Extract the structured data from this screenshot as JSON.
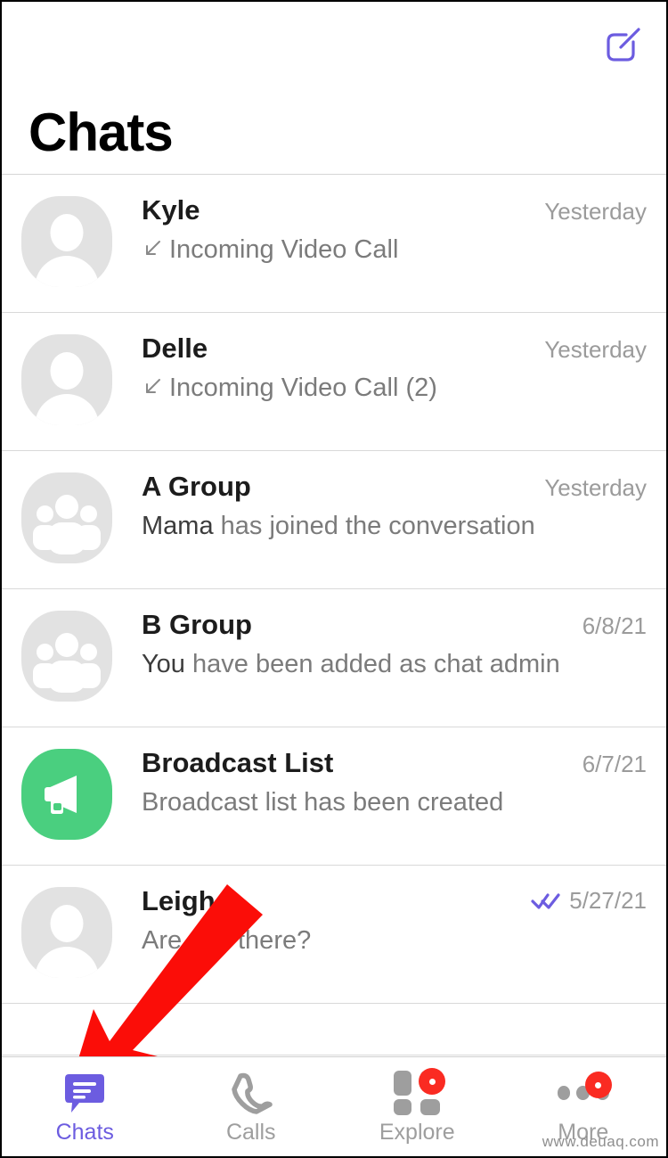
{
  "header": {
    "title": "Chats",
    "compose_icon": "compose-icon",
    "accent_color": "#6C5CE0"
  },
  "chats": [
    {
      "name": "Kyle",
      "avatar_type": "person",
      "preview_icon": "incoming-call-arrow-icon",
      "preview_strong": "",
      "preview": "Incoming Video Call",
      "time": "Yesterday",
      "read_receipt": ""
    },
    {
      "name": "Delle",
      "avatar_type": "person",
      "preview_icon": "incoming-call-arrow-icon",
      "preview_strong": "",
      "preview": "Incoming Video Call (2)",
      "time": "Yesterday",
      "read_receipt": ""
    },
    {
      "name": "A Group",
      "avatar_type": "group",
      "preview_icon": "",
      "preview_strong": "Mama",
      "preview": "has joined the conversation",
      "time": "Yesterday",
      "read_receipt": ""
    },
    {
      "name": "B Group",
      "avatar_type": "group",
      "preview_icon": "",
      "preview_strong": "You",
      "preview": "have been added as chat admin",
      "time": "6/8/21",
      "read_receipt": ""
    },
    {
      "name": "Broadcast List",
      "avatar_type": "broadcast",
      "preview_icon": "",
      "preview_strong": "",
      "preview": "Broadcast list has been created",
      "time": "6/7/21",
      "read_receipt": ""
    },
    {
      "name": "Leigh",
      "avatar_type": "person",
      "preview_icon": "",
      "preview_strong": "",
      "preview": "Are you there?",
      "time": "5/27/21",
      "read_receipt": "double-check-icon"
    }
  ],
  "tabs": [
    {
      "label": "Chats",
      "icon": "chat-bubble-icon",
      "active": true,
      "badge": false
    },
    {
      "label": "Calls",
      "icon": "phone-icon",
      "active": false,
      "badge": false
    },
    {
      "label": "Explore",
      "icon": "grid-icon",
      "active": false,
      "badge": true
    },
    {
      "label": "More",
      "icon": "ellipsis-icon",
      "active": false,
      "badge": true
    }
  ],
  "annotation": {
    "arrow_color": "#FB0D08",
    "points_to": "Chats"
  },
  "watermark": "www.deuaq.com",
  "colors": {
    "accent": "#6C5CE0",
    "broadcast_green": "#4ACF7F",
    "badge_red": "#FA2B22",
    "avatar_gray": "#E2E2E2"
  }
}
